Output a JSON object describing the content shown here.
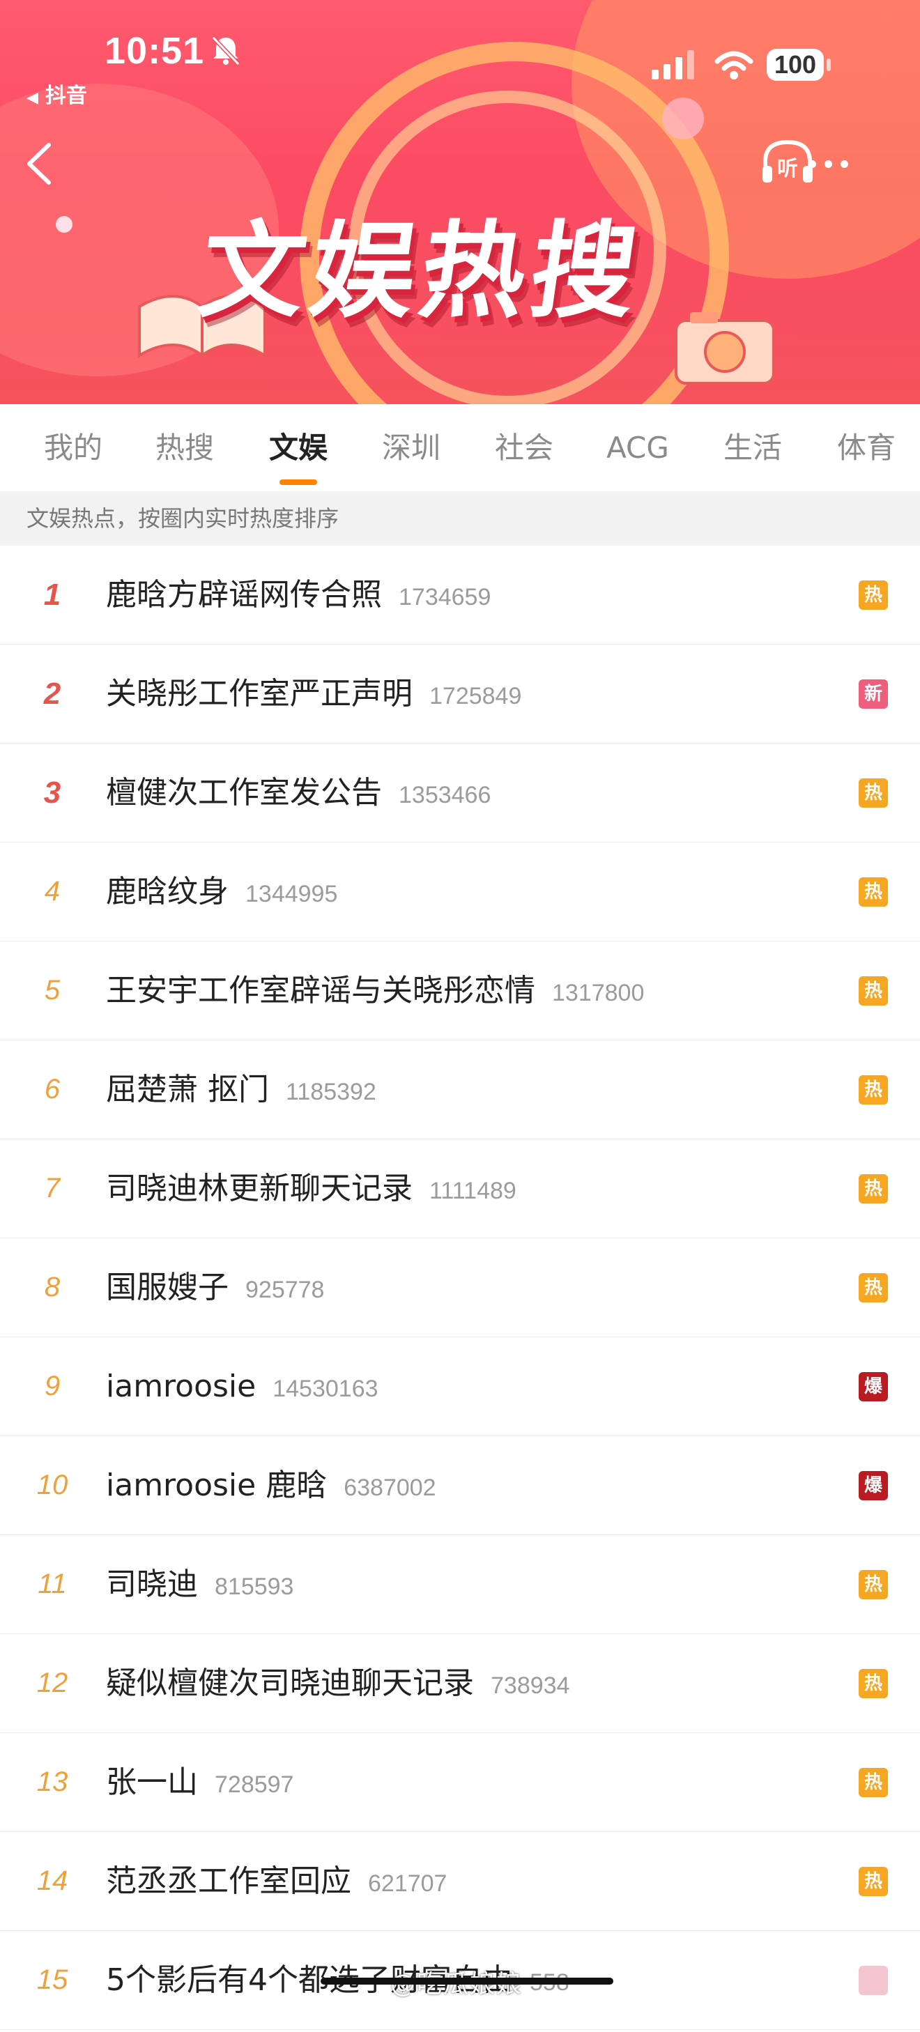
{
  "status_bar": {
    "time": "10:51",
    "back_app": "抖音",
    "battery": "100"
  },
  "banner": {
    "title": "文娱热搜",
    "listen_label": "听"
  },
  "tabs": [
    {
      "label": "我的",
      "active": false
    },
    {
      "label": "热搜",
      "active": false
    },
    {
      "label": "文娱",
      "active": true
    },
    {
      "label": "深圳",
      "active": false
    },
    {
      "label": "社会",
      "active": false
    },
    {
      "label": "ACG",
      "active": false
    },
    {
      "label": "生活",
      "active": false
    },
    {
      "label": "体育",
      "active": false
    }
  ],
  "hint": "文娱热点，按圈内实时热度排序",
  "badge_colors": {
    "热": "#f5a623",
    "新": "#ee5e7d",
    "爆": "#b81c22"
  },
  "items": [
    {
      "rank": "1",
      "title": "鹿晗方辟谣网传合照",
      "count": "1734659",
      "badge": "热"
    },
    {
      "rank": "2",
      "title": "关晓彤工作室严正声明",
      "count": "1725849",
      "badge": "新"
    },
    {
      "rank": "3",
      "title": "檀健次工作室发公告",
      "count": "1353466",
      "badge": "热"
    },
    {
      "rank": "4",
      "title": "鹿晗纹身",
      "count": "1344995",
      "badge": "热"
    },
    {
      "rank": "5",
      "title": "王安宇工作室辟谣与关晓彤恋情",
      "count": "1317800",
      "badge": "热"
    },
    {
      "rank": "6",
      "title": "屈楚萧 抠门",
      "count": "1185392",
      "badge": "热"
    },
    {
      "rank": "7",
      "title": "司晓迪林更新聊天记录",
      "count": "1111489",
      "badge": "热"
    },
    {
      "rank": "8",
      "title": "国服嫂子",
      "count": "925778",
      "badge": "热"
    },
    {
      "rank": "9",
      "title": "iamroosie",
      "count": "14530163",
      "badge": "爆"
    },
    {
      "rank": "10",
      "title": "iamroosie 鹿晗",
      "count": "6387002",
      "badge": "爆"
    },
    {
      "rank": "11",
      "title": "司晓迪",
      "count": "815593",
      "badge": "热"
    },
    {
      "rank": "12",
      "title": "疑似檀健次司晓迪聊天记录",
      "count": "738934",
      "badge": "热"
    },
    {
      "rank": "13",
      "title": "张一山",
      "count": "728597",
      "badge": "热"
    },
    {
      "rank": "14",
      "title": "范丞丞工作室回应",
      "count": "621707",
      "badge": "热"
    },
    {
      "rank": "15",
      "title": "5个影后有4个都选了财富自由",
      "count": "558",
      "badge": ""
    }
  ],
  "watermark": "@吃瓜娘娘"
}
